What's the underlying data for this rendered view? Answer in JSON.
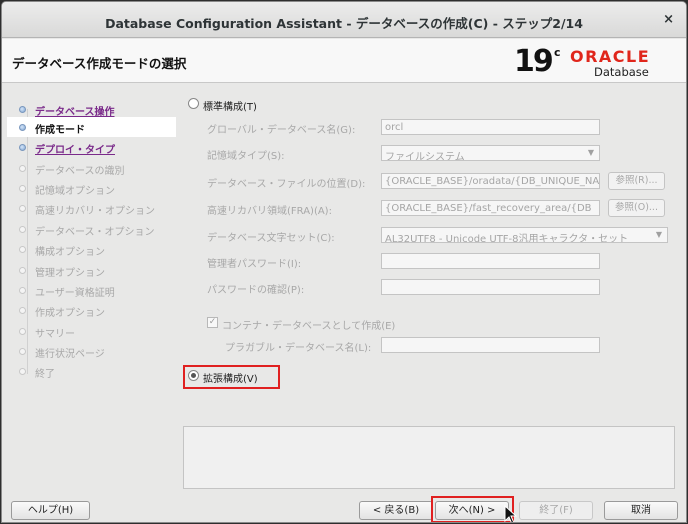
{
  "window": {
    "title": "Database Configuration Assistant - データベースの作成(C) - ステップ2/14",
    "close_glyph": "×"
  },
  "header": {
    "title": "データベース作成モードの選択",
    "logo": {
      "version": "19",
      "suffix": "c",
      "brand": "ORACLE",
      "product": "Database"
    }
  },
  "nav": {
    "items": [
      {
        "label": "データベース操作",
        "state": "link"
      },
      {
        "label": "作成モード",
        "state": "current"
      },
      {
        "label": "デプロイ・タイプ",
        "state": "link"
      },
      {
        "label": "データベースの識別",
        "state": "dim"
      },
      {
        "label": "記憶域オプション",
        "state": "dim"
      },
      {
        "label": "高速リカバリ・オプション",
        "state": "dim"
      },
      {
        "label": "データベース・オプション",
        "state": "dim"
      },
      {
        "label": "構成オプション",
        "state": "dim"
      },
      {
        "label": "管理オプション",
        "state": "dim"
      },
      {
        "label": "ユーザー資格証明",
        "state": "dim"
      },
      {
        "label": "作成オプション",
        "state": "dim"
      },
      {
        "label": "サマリー",
        "state": "dim"
      },
      {
        "label": "進行状況ページ",
        "state": "dim"
      },
      {
        "label": "終了",
        "state": "dim"
      }
    ]
  },
  "form": {
    "typical_radio_label": "標準構成(T)",
    "global_db_name_label": "グローバル・データベース名(G):",
    "global_db_name_value": "orcl",
    "storage_type_label": "記憶域タイプ(S):",
    "storage_type_value": "ファイルシステム",
    "db_file_location_label": "データベース・ファイルの位置(D):",
    "db_file_location_value": "{ORACLE_BASE}/oradata/{DB_UNIQUE_NA",
    "browse1_label": "参照(R)...",
    "fra_label": "高速リカバリ領域(FRA)(A):",
    "fra_value": "{ORACLE_BASE}/fast_recovery_area/{DB",
    "browse2_label": "参照(O)...",
    "charset_label": "データベース文字セット(C):",
    "charset_value": "AL32UTF8 - Unicode UTF-8汎用キャラクタ・セット",
    "admin_password_label": "管理者パスワード(I):",
    "admin_password_value": "",
    "confirm_password_label": "パスワードの確認(P):",
    "confirm_password_value": "",
    "container_db_checkbox_label": "コンテナ・データベースとして作成(E)",
    "container_db_checked": true,
    "pdb_name_label": "プラガブル・データベース名(L):",
    "pdb_name_value": "",
    "advanced_radio_label": "拡張構成(V)",
    "selected_mode": "advanced",
    "check_glyph": "✓"
  },
  "buttons": {
    "help": "ヘルプ(H)",
    "back": "< 戻る(B)",
    "next": "次へ(N) >",
    "finish": "終了(F)",
    "cancel": "取消"
  },
  "colors": {
    "highlight_border": "#e02020",
    "oracle_red": "#e0261b",
    "nav_link": "#7a2a8a"
  }
}
